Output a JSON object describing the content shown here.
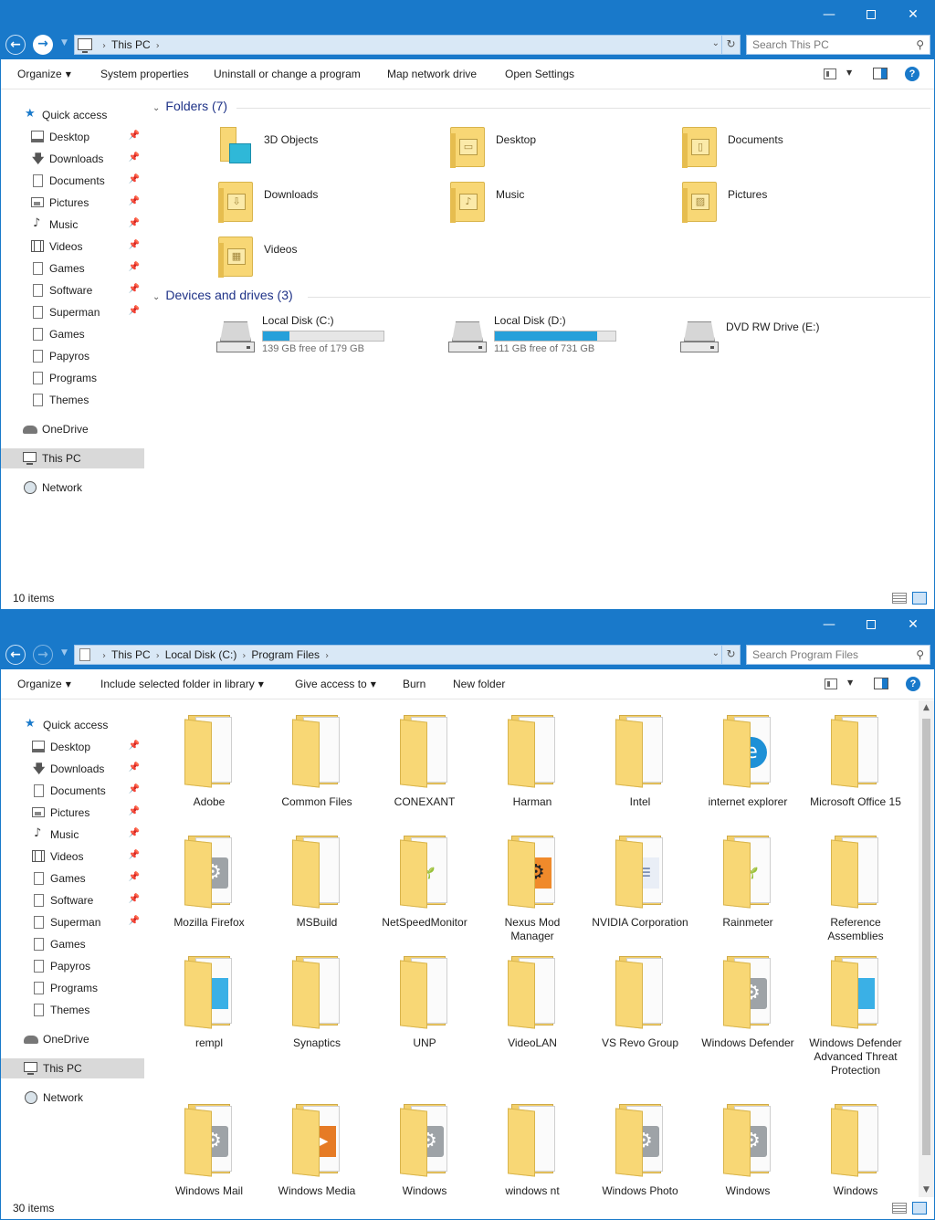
{
  "colors": {
    "accent": "#1979ca",
    "folder": "#f8d775",
    "drive_fill": "#26a0da",
    "group_header": "#1e3287"
  },
  "window1": {
    "titlebar": {
      "minimize": "—",
      "maximize": "",
      "close": "✕"
    },
    "address": {
      "crumbs": [
        "This PC"
      ]
    },
    "search": {
      "placeholder": "Search This PC"
    },
    "commands": {
      "organize": "Organize",
      "system_properties": "System properties",
      "uninstall": "Uninstall or change a program",
      "map_drive": "Map network drive",
      "open_settings": "Open Settings",
      "help": "?"
    },
    "sidebar": {
      "quick_access": "Quick access",
      "items": [
        {
          "label": "Desktop",
          "icon": "desktop-icon",
          "pinned": true
        },
        {
          "label": "Downloads",
          "icon": "download-icon",
          "pinned": true
        },
        {
          "label": "Documents",
          "icon": "documents-icon",
          "pinned": true
        },
        {
          "label": "Pictures",
          "icon": "pictures-icon",
          "pinned": true
        },
        {
          "label": "Music",
          "icon": "music-icon",
          "pinned": true
        },
        {
          "label": "Videos",
          "icon": "videos-icon",
          "pinned": true
        },
        {
          "label": "Games",
          "icon": "folder-icon",
          "pinned": true
        },
        {
          "label": "Software",
          "icon": "folder-icon",
          "pinned": true
        },
        {
          "label": "Superman",
          "icon": "folder-icon",
          "pinned": true
        },
        {
          "label": "Games",
          "icon": "folder-icon",
          "pinned": false
        },
        {
          "label": "Papyros",
          "icon": "folder-icon",
          "pinned": false
        },
        {
          "label": "Programs",
          "icon": "folder-icon",
          "pinned": false
        },
        {
          "label": "Themes",
          "icon": "folder-icon",
          "pinned": false
        }
      ],
      "onedrive": "OneDrive",
      "this_pc": "This PC",
      "network": "Network"
    },
    "folders_header": "Folders (7)",
    "folders": [
      {
        "name": "3D Objects",
        "icon": "3d-objects-icon"
      },
      {
        "name": "Desktop",
        "icon": "desktop-folder-icon"
      },
      {
        "name": "Documents",
        "icon": "documents-folder-icon"
      },
      {
        "name": "Downloads",
        "icon": "downloads-folder-icon"
      },
      {
        "name": "Music",
        "icon": "music-folder-icon"
      },
      {
        "name": "Pictures",
        "icon": "pictures-folder-icon"
      },
      {
        "name": "Videos",
        "icon": "videos-folder-icon"
      }
    ],
    "devices_header": "Devices and drives (3)",
    "drives": [
      {
        "name": "Local Disk (C:)",
        "free": "139 GB free of 179 GB",
        "used_fraction": 0.22
      },
      {
        "name": "Local Disk (D:)",
        "free": "111 GB free of 731 GB",
        "used_fraction": 0.85
      },
      {
        "name": "DVD RW Drive (E:)",
        "free": "",
        "used_fraction": null
      }
    ],
    "status": "10 items"
  },
  "window2": {
    "titlebar": {
      "minimize": "—",
      "maximize": "",
      "close": "✕"
    },
    "address": {
      "crumbs": [
        "This PC",
        "Local Disk (C:)",
        "Program Files"
      ]
    },
    "search": {
      "placeholder": "Search Program Files"
    },
    "commands": {
      "organize": "Organize",
      "include_library": "Include selected folder in library",
      "give_access": "Give access to",
      "burn": "Burn",
      "new_folder": "New folder",
      "help": "?"
    },
    "sidebar": {
      "quick_access": "Quick access",
      "items": [
        {
          "label": "Desktop",
          "icon": "desktop-icon",
          "pinned": true
        },
        {
          "label": "Downloads",
          "icon": "download-icon",
          "pinned": true
        },
        {
          "label": "Documents",
          "icon": "documents-icon",
          "pinned": true
        },
        {
          "label": "Pictures",
          "icon": "pictures-icon",
          "pinned": true
        },
        {
          "label": "Music",
          "icon": "music-icon",
          "pinned": true
        },
        {
          "label": "Videos",
          "icon": "videos-icon",
          "pinned": true
        },
        {
          "label": "Games",
          "icon": "folder-icon",
          "pinned": true
        },
        {
          "label": "Software",
          "icon": "folder-icon",
          "pinned": true
        },
        {
          "label": "Superman",
          "icon": "folder-icon",
          "pinned": true
        },
        {
          "label": "Games",
          "icon": "folder-icon",
          "pinned": false
        },
        {
          "label": "Papyros",
          "icon": "folder-icon",
          "pinned": false
        },
        {
          "label": "Programs",
          "icon": "folder-icon",
          "pinned": false
        },
        {
          "label": "Themes",
          "icon": "folder-icon",
          "pinned": false
        }
      ],
      "onedrive": "OneDrive",
      "this_pc": "This PC",
      "network": "Network"
    },
    "items": [
      {
        "name": "Adobe",
        "badge": ""
      },
      {
        "name": "Common Files",
        "badge": ""
      },
      {
        "name": "CONEXANT",
        "badge": ""
      },
      {
        "name": "Harman",
        "badge": ""
      },
      {
        "name": "Intel",
        "badge": ""
      },
      {
        "name": "internet explorer",
        "badge": "ie"
      },
      {
        "name": "Microsoft Office 15",
        "badge": ""
      },
      {
        "name": "Mozilla Firefox",
        "badge": "gear"
      },
      {
        "name": "MSBuild",
        "badge": ""
      },
      {
        "name": "NetSpeedMonitor",
        "badge": "leaf"
      },
      {
        "name": "Nexus Mod Manager",
        "badge": "nexus"
      },
      {
        "name": "NVIDIA Corporation",
        "badge": "doc"
      },
      {
        "name": "Rainmeter",
        "badge": "leaf"
      },
      {
        "name": "Reference Assemblies",
        "badge": ""
      },
      {
        "name": "rempl",
        "badge": "blue"
      },
      {
        "name": "Synaptics",
        "badge": ""
      },
      {
        "name": "UNP",
        "badge": ""
      },
      {
        "name": "VideoLAN",
        "badge": ""
      },
      {
        "name": "VS Revo Group",
        "badge": ""
      },
      {
        "name": "Windows Defender",
        "badge": "gear"
      },
      {
        "name": "Windows Defender Advanced Threat Protection",
        "badge": "blue"
      },
      {
        "name": "Windows Mail",
        "badge": "gear"
      },
      {
        "name": "Windows Media",
        "badge": "media"
      },
      {
        "name": "Windows",
        "badge": "gear"
      },
      {
        "name": "windows nt",
        "badge": ""
      },
      {
        "name": "Windows Photo",
        "badge": "gear"
      },
      {
        "name": "Windows",
        "badge": "gear"
      },
      {
        "name": "Windows",
        "badge": ""
      }
    ],
    "status": "30 items"
  }
}
